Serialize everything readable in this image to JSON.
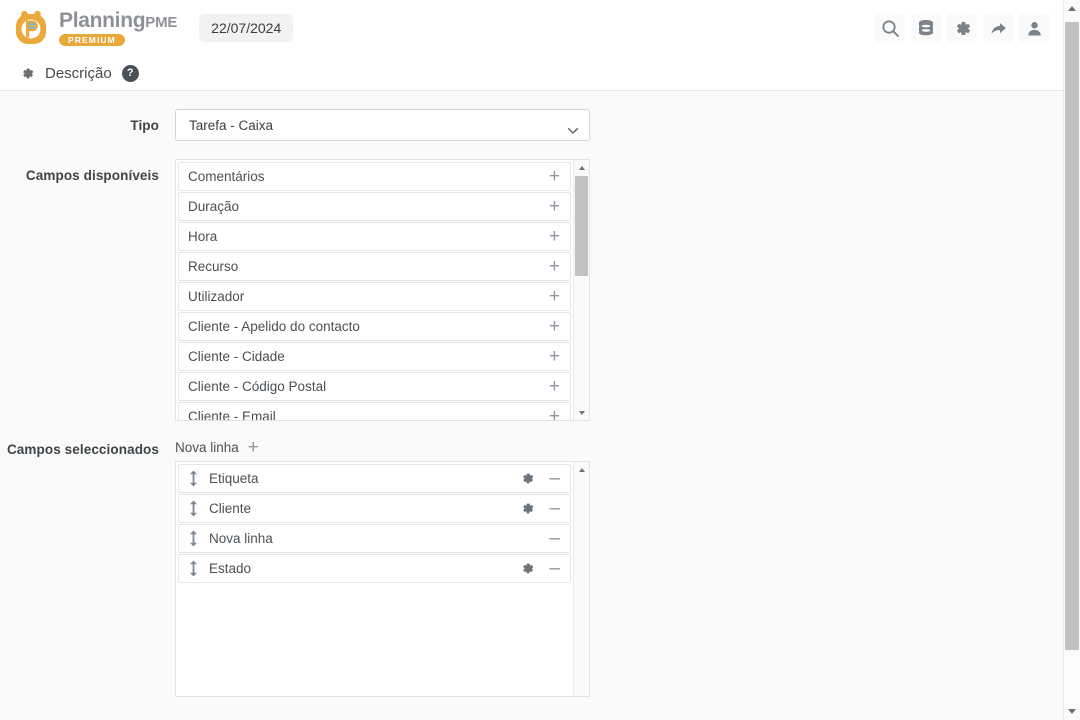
{
  "app": {
    "brand_planning": "Planning",
    "brand_pme": "PME",
    "brand_badge": "PREMIUM",
    "date": "22/07/2024"
  },
  "topbar": {
    "actions": [
      {
        "name": "search-icon",
        "label": "Pesquisar"
      },
      {
        "name": "database-icon",
        "label": "Dados"
      },
      {
        "name": "gear-icon",
        "label": "Definições"
      },
      {
        "name": "share-icon",
        "label": "Partilhar"
      },
      {
        "name": "user-icon",
        "label": "Utilizador"
      }
    ]
  },
  "section": {
    "gear": "gear-icon",
    "title": "Descrição",
    "help": "?"
  },
  "form": {
    "tipo": {
      "label": "Tipo",
      "selected": "Tarefa - Caixa",
      "options": [
        "Tarefa - Caixa"
      ]
    },
    "available": {
      "label": "Campos disponíveis",
      "items": [
        {
          "label": "Comentários",
          "action": "+"
        },
        {
          "label": "Duração",
          "action": "+"
        },
        {
          "label": "Hora",
          "action": "+"
        },
        {
          "label": "Recurso",
          "action": "+"
        },
        {
          "label": "Utilizador",
          "action": "+"
        },
        {
          "label": "Cliente - Apelido do contacto",
          "action": "+"
        },
        {
          "label": "Cliente - Cidade",
          "action": "+"
        },
        {
          "label": "Cliente - Código Postal",
          "action": "+"
        },
        {
          "label": "Cliente - Email",
          "action": "+"
        }
      ]
    },
    "selected": {
      "label": "Campos seleccionados",
      "new_line_label": "Nova linha",
      "new_line_plus": "+",
      "items": [
        {
          "label": "Etiqueta",
          "has_gear": true,
          "minus": "–"
        },
        {
          "label": "Cliente",
          "has_gear": true,
          "minus": "–"
        },
        {
          "label": "Nova linha",
          "has_gear": false,
          "minus": "–"
        },
        {
          "label": "Estado",
          "has_gear": true,
          "minus": "–"
        }
      ]
    }
  },
  "colors": {
    "brand_orange": "#e8a93a",
    "brand_gray": "#8e9196",
    "icon_gray": "#7b8289",
    "accent_blue_gray": "#8e97a4",
    "body_bg": "#fafafa"
  }
}
